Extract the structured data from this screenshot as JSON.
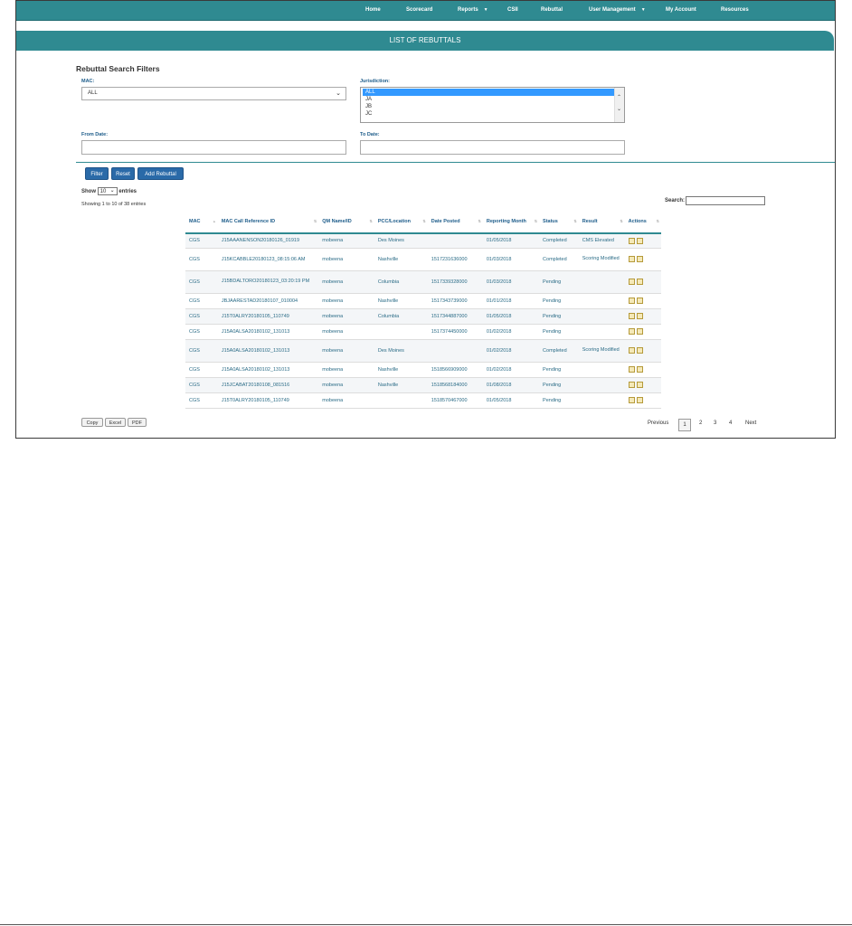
{
  "nav": {
    "items": [
      {
        "label": "Home"
      },
      {
        "label": "Scorecard"
      },
      {
        "label": "Reports",
        "dropdown": true
      },
      {
        "label": "CSII"
      },
      {
        "label": "Rebuttal"
      },
      {
        "label": "User Management",
        "dropdown": true
      },
      {
        "label": "My Account"
      },
      {
        "label": "Resources"
      }
    ],
    "caret": "▼"
  },
  "page_title": "LIST OF REBUTTALS",
  "filters": {
    "title": "Rebuttal Search Filters",
    "mac_label": "MAC:",
    "mac_value": "ALL",
    "jurisdiction_label": "Jurisdiction:",
    "jurisdiction_options": [
      "ALL",
      "JA",
      "JB",
      "JC"
    ],
    "jurisdiction_selected": "ALL",
    "from_date_label": "From Date:",
    "to_date_label": "To Date:",
    "from_date_value": "",
    "to_date_value": ""
  },
  "buttons": {
    "filter": "Filter",
    "reset": "Reset",
    "add_rebuttal": "Add Rebuttal"
  },
  "length_menu": {
    "show": "Show",
    "value": "10",
    "entries": "entries"
  },
  "info_text": "Showing 1 to 10 of 38 entries",
  "search": {
    "label": "Search:",
    "value": ""
  },
  "columns": [
    "MAC",
    "MAC Call Reference ID",
    "QM Name/ID",
    "PCC/Location",
    "Date Posted",
    "Reporting Month",
    "Status",
    "Result",
    "Actions"
  ],
  "rows": [
    {
      "cells": [
        "CGS",
        "J15AAANENSON20180126_01919",
        "mobeena",
        "Des Moines",
        "",
        "01/05/2018",
        "Completed",
        "CMS Elevated"
      ]
    },
    {
      "cells": [
        "CGS",
        "J15KCABBLE20180123_08:15:06 AM",
        "mobeena",
        "Nashville",
        "1517231636000",
        "01/03/2018",
        "Completed",
        "Scoring Modified"
      ]
    },
    {
      "cells": [
        "CGS",
        "J15BDALTORO20180123_03:20:19 PM",
        "mobeena",
        "Columbia",
        "1517339328000",
        "01/03/2018",
        "Pending",
        ""
      ]
    },
    {
      "cells": [
        "CGS",
        "JBJAARESTAD20180107_010004",
        "mobeena",
        "Nashville",
        "1517343739000",
        "01/01/2018",
        "Pending",
        ""
      ]
    },
    {
      "cells": [
        "CGS",
        "J15T0ALRY20180105_110749",
        "mobeena",
        "Columbia",
        "1517344887000",
        "01/05/2018",
        "Pending",
        ""
      ]
    },
    {
      "cells": [
        "CGS",
        "J15A0ALSA20180102_131013",
        "mobeena",
        "",
        "1517374450000",
        "01/02/2018",
        "Pending",
        ""
      ]
    },
    {
      "cells": [
        "CGS",
        "J15A0ALSA20180102_131013",
        "mobeena",
        "Des Moines",
        "",
        "01/02/2018",
        "Completed",
        "Scoring Modified"
      ]
    },
    {
      "cells": [
        "CGS",
        "J15A0ALSA20180102_131013",
        "mobeena",
        "Nashville",
        "1518566909000",
        "01/02/2018",
        "Pending",
        ""
      ]
    },
    {
      "cells": [
        "CGS",
        "J15JCABAT20180108_081516",
        "mobeena",
        "Nashville",
        "1518568184000",
        "01/08/2018",
        "Pending",
        ""
      ]
    },
    {
      "cells": [
        "CGS",
        "J15T0ALRY20180105_110749",
        "mobeena",
        "",
        "1518570467000",
        "01/05/2018",
        "Pending",
        ""
      ]
    }
  ],
  "export": {
    "copy": "Copy",
    "excel": "Excel",
    "pdf": "PDF"
  },
  "pagination": {
    "previous": "Previous",
    "pages": [
      "1",
      "2",
      "3",
      "4"
    ],
    "current": "1",
    "next": "Next"
  }
}
